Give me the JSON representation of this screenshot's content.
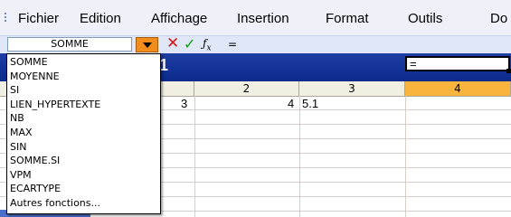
{
  "menu": {
    "items": [
      {
        "label": "Fichier"
      },
      {
        "label": "Edition"
      },
      {
        "label": "Affichage"
      },
      {
        "label": "Insertion"
      },
      {
        "label": "Format"
      },
      {
        "label": "Outils"
      },
      {
        "label": "Do"
      }
    ]
  },
  "formula_bar": {
    "name_box": "SOMME",
    "fx": "fx",
    "formula": "="
  },
  "sheet": {
    "title_number": "1",
    "col_headers": [
      "2",
      "3",
      "4"
    ],
    "cells": {
      "a": "3",
      "b": "4",
      "c": "5.1",
      "active": "="
    }
  },
  "function_list": {
    "items": [
      "SOMME",
      "MOYENNE",
      "SI",
      "LIEN_HYPERTEXTE",
      "NB",
      "MAX",
      "SIN",
      "SOMME.SI",
      "VPM",
      "ECARTYPE",
      "Autres fonctions..."
    ]
  },
  "colors": {
    "accent": "#f28c1b",
    "selected_header": "#f8b43d",
    "title_strip": "#0a2a8c",
    "cancel": "#d11a1a",
    "confirm": "#169a1a"
  }
}
